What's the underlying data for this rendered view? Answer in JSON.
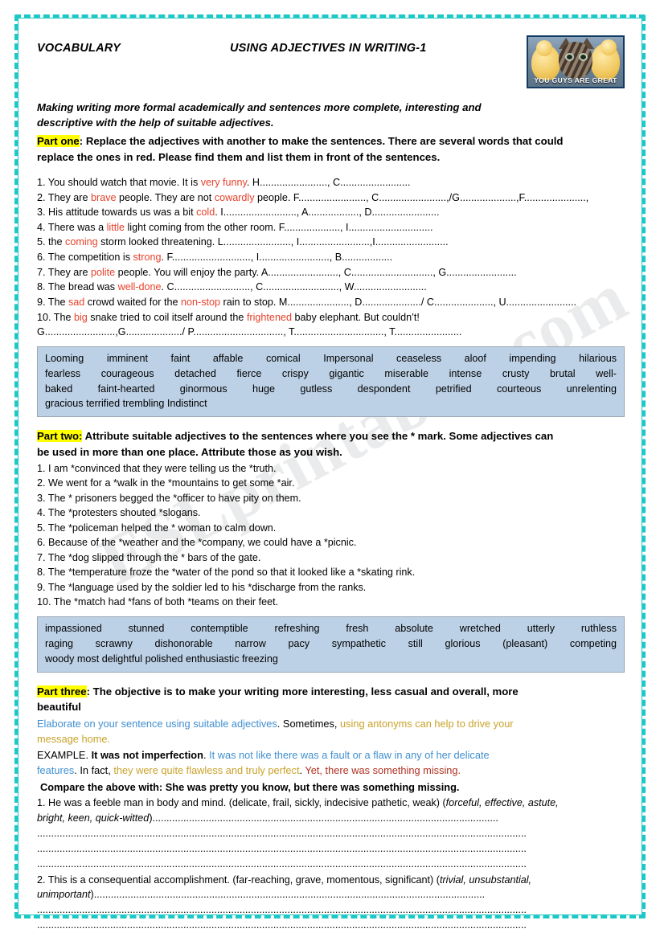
{
  "document": {
    "header": {
      "left_title": "VOCABULARY",
      "center_title": "USING ADJECTIVES IN WRITING-1",
      "photo": {
        "icon": "kitten-ducklings-photo",
        "caption": "YOU GUYS ARE GREAT"
      }
    },
    "watermark": "ESLprintables.com",
    "intro": {
      "line1": "Making writing more formal academically and sentences more complete, interesting and",
      "line2": "descriptive with the help of suitable adjectives."
    },
    "part_one": {
      "label": "Part one",
      "instruction_line1": ": Replace the adjectives with another to make the sentences. There are several words that could",
      "instruction_line2": "replace the ones in red. Please find them and list them in front of the sentences.",
      "sentences": [
        {
          "num": "1.",
          "pre": "You should watch that movie. It is ",
          "red": "very funny",
          "post": ". H........................, C........................."
        },
        {
          "num": "2.",
          "pre": "They are ",
          "red": "brave",
          "mid": " people.   They are not ",
          "red2": "cowardly",
          "post": " people. F........................, C........................,/G....................,F......................,"
        },
        {
          "num": "3.",
          "pre": "His attitude towards us was a bit ",
          "red": "cold",
          "post": ". I.........................., A.................., D........................"
        },
        {
          "num": "4.",
          "pre": "There was a ",
          "red": "little",
          "post": " light coming from the other room. F...................., I.............................."
        },
        {
          "num": "5.",
          "pre": "the ",
          "red": "coming",
          "post": " storm looked threatening. L........................, I.........................,I.........................."
        },
        {
          "num": "6.",
          "pre": "The competition is ",
          "red": "strong",
          "post": ". F............................, I........................., B.................."
        },
        {
          "num": "7.",
          "pre": "They are ",
          "red": "polite",
          "post": " people. You will enjoy the party. A........................., C............................., G........................."
        },
        {
          "num": "8.",
          "pre": "The bread was ",
          "red": "well-done",
          "post": ". C..........................., C..........................., W.........................."
        },
        {
          "num": "9.",
          "pre": "The ",
          "red": "sad",
          "mid": " crowd waited for the ",
          "red2": "non-stop",
          "post": " rain to stop. M......................, D...................../ C....................., U........................."
        },
        {
          "num": "10.",
          "pre": "The ",
          "red": "big",
          "mid": " snake tried to coil itself around the ",
          "red2": "frightened",
          "post": " baby elephant. But couldn’t!"
        },
        {
          "num": "",
          "pre": "G.........................,G..................../ P................................, T................................, T........................"
        }
      ],
      "wordbank": [
        "Looming   imminent   faint   affable   comical   Impersonal   ceaseless   aloof   impending   hilarious",
        "fearless   courageous   detached   fierce   crispy   gigantic   miserable   intense   crusty   brutal   well-",
        "baked   faint-hearted   ginormous   huge   gutless   despondent   petrified   courteous   unrelenting",
        "gracious   terrified   trembling   Indistinct"
      ]
    },
    "part_two": {
      "label": "Part two:",
      "instruction_line1": " Attribute suitable adjectives to the sentences where you see the * mark. Some adjectives can",
      "instruction_line2": "be used in more than one place. Attribute those as you wish.",
      "sentences": [
        "1. I am *convinced that they were telling us the *truth.",
        "2. We went for a *walk in the *mountains to get some *air.",
        "3. The * prisoners begged the *officer to have pity on them.",
        "4. The *protesters shouted *slogans.",
        "5. The *policeman helped the * woman to calm down.",
        "6. Because of the *weather and the *company,  we could have a *picnic.",
        "7. The *dog slipped through the * bars of the gate.",
        "8. The *temperature froze the *water of the pond so that it looked like a *skating rink.",
        "9. The *language used by the soldier led to his *discharge from the ranks.",
        "10. The *match had *fans of both *teams on their feet."
      ],
      "wordbank": [
        "impassioned   stunned  contemptible  refreshing   fresh   absolute   wretched   utterly   ruthless",
        "raging   scrawny  dishonorable   narrow   pacy  sympathetic   still    glorious (pleasant)    competing",
        "woody  most delightful    polished  enthusiastic   freezing"
      ]
    },
    "part_three": {
      "label": "Part three",
      "instruction_line1": ": The objective is to make your writing more interesting, less casual and overall, more",
      "instruction_line2": "beautiful",
      "elaborate_blue": "Elaborate on your sentence using suitable adjectives",
      "elaborate_mid": ". Sometimes, ",
      "elaborate_gold1": "using antonyms can help to drive your",
      "elaborate_gold2": "message home.",
      "example_label": "EXAMPLE. ",
      "example_bold": "It was not imperfection",
      "example_dot": ". ",
      "example_blue1": "It was not like there was a fault or a flaw in any of her delicate",
      "example_blue2": "features",
      "example_mid": ". In fact, ",
      "example_gold": "they were quite flawless and truly perfect",
      "example_dot2": ". ",
      "example_red": "Yet, there was something missing.",
      "compare": " Compare the above with: She was pretty you know, but there was something missing.",
      "questions": [
        {
          "line1_pre": "1. He was a feeble man in body and mind. (delicate, frail, sickly, indecisive pathetic, weak) (",
          "line1_ital": "forceful, effective, astute,",
          "line2_ital": "bright, keen, quick-witted",
          "line2_post": ")..........................................................................................................................."
        },
        {
          "line1_pre": "2. This is a consequential accomplishment. (far-reaching, grave, momentous, significant) (",
          "line1_ital": "trivial, unsubstantial,",
          "line2_ital": "unimportant",
          "line2_post": ")..........................................................................................................................................."
        }
      ],
      "dot_line": ".............................................................................................................................................................................."
    }
  },
  "colors": {
    "frame": "#1ec8c8",
    "highlight": "#ffff00",
    "red_word": "#e8402a",
    "wordbank_bg": "#bdd1e6",
    "blue_text": "#3f8fd0",
    "gold_text": "#c9a22a",
    "dark_red_text": "#b03020"
  }
}
